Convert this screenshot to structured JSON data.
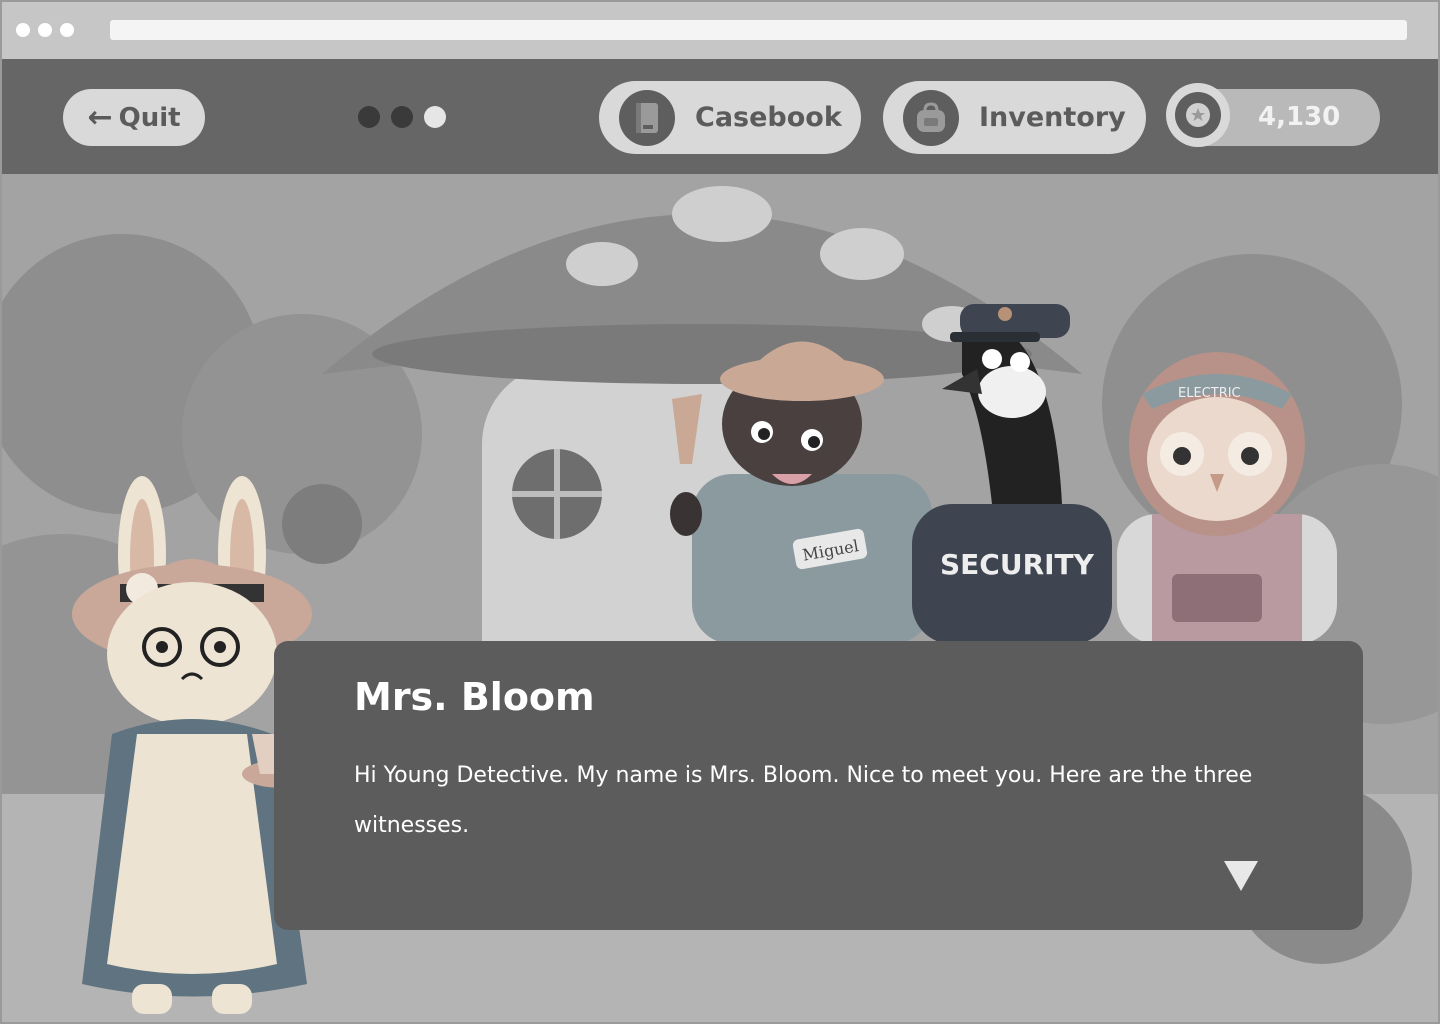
{
  "browser": {
    "url": ""
  },
  "topbar": {
    "quit_label": "Quit",
    "progress": {
      "total": 3,
      "filled": 2
    },
    "casebook_label": "Casebook",
    "inventory_label": "Inventory",
    "coins": "4,130"
  },
  "scene": {
    "background": "mushroom-house-garden",
    "witnesses": [
      {
        "name_tag": "Miguel"
      },
      {
        "shirt_text": "SECURITY"
      },
      {
        "cap_text": "ELECTRIC"
      }
    ]
  },
  "dialog": {
    "speaker": "Mrs. Bloom",
    "text": "Hi Young Detective. My name is Mrs. Bloom. Nice to meet you. Here are the three witnesses."
  },
  "colors": {
    "topbar": "#666666",
    "pill": "#d9d9d9",
    "dialog": "#5c5c5c",
    "progress_filled": "#3a3a3a",
    "progress_empty": "#e6e6e6"
  }
}
